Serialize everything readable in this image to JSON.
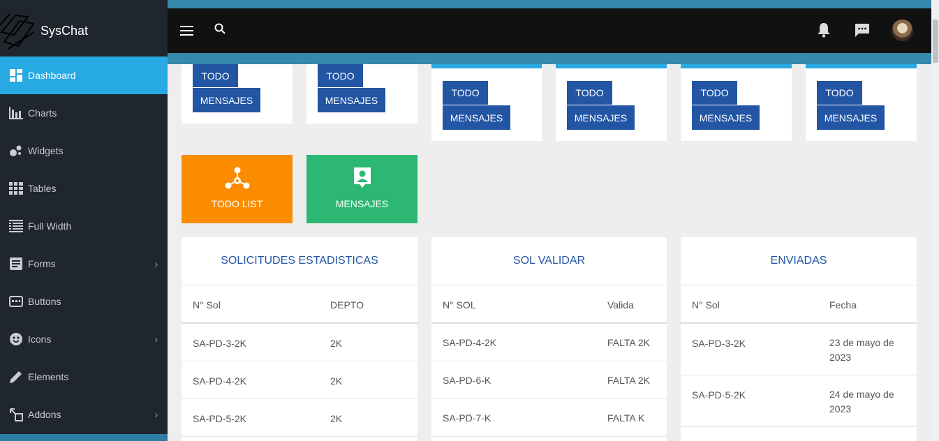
{
  "app": {
    "name": "SysChat"
  },
  "sidebar": {
    "items": [
      {
        "label": "Dashboard",
        "icon": "dashboard-icon",
        "active": true,
        "has_submenu": false
      },
      {
        "label": "Charts",
        "icon": "bar-chart-icon",
        "active": false,
        "has_submenu": false
      },
      {
        "label": "Widgets",
        "icon": "bubbles-icon",
        "active": false,
        "has_submenu": false
      },
      {
        "label": "Tables",
        "icon": "table-icon",
        "active": false,
        "has_submenu": false
      },
      {
        "label": "Full Width",
        "icon": "list-view-icon",
        "active": false,
        "has_submenu": false
      },
      {
        "label": "Forms",
        "icon": "form-icon",
        "active": false,
        "has_submenu": true
      },
      {
        "label": "Buttons",
        "icon": "button-icon",
        "active": false,
        "has_submenu": false
      },
      {
        "label": "Icons",
        "icon": "face-icon",
        "active": false,
        "has_submenu": true
      },
      {
        "label": "Elements",
        "icon": "pencil-icon",
        "active": false,
        "has_submenu": false
      },
      {
        "label": "Addons",
        "icon": "addons-icon",
        "active": false,
        "has_submenu": true
      }
    ]
  },
  "topbar": {
    "menu_icon": "hamburger-icon",
    "search_icon": "search-icon",
    "bell_icon": "bell-icon",
    "chat_icon": "chat-icon"
  },
  "cards": {
    "todo_label": "TODO",
    "mensajes_label": "MENSAJES"
  },
  "tiles": [
    {
      "label": "TODO LIST",
      "color": "#fb8c00",
      "icon": "hub-icon"
    },
    {
      "label": "MENSAJES",
      "color": "#2cb872",
      "icon": "contact-icon"
    }
  ],
  "colors": {
    "accent": "#27a9e3",
    "button_blue": "#2255a4",
    "sidebar_bg": "#1f262d",
    "topbar_bg": "#111111"
  },
  "tables": [
    {
      "title": "SOLICITUDES ESTADISTICAS",
      "headers": [
        "N° Sol",
        "DEPTO"
      ],
      "rows": [
        [
          "SA-PD-3-2K",
          "2K"
        ],
        [
          "SA-PD-4-2K",
          "2K"
        ],
        [
          "SA-PD-5-2K",
          "2K"
        ]
      ]
    },
    {
      "title": "SOL VALIDAR",
      "headers": [
        "N° SOL",
        "Valida"
      ],
      "rows": [
        [
          "SA-PD-4-2K",
          "FALTA 2K"
        ],
        [
          "SA-PD-6-K",
          "FALTA 2K"
        ],
        [
          "SA-PD-7-K",
          "FALTA K"
        ]
      ]
    },
    {
      "title": "ENVIADAS",
      "headers": [
        "N° Sol",
        "Fecha"
      ],
      "rows": [
        [
          "SA-PD-3-2K",
          "23 de mayo de 2023"
        ],
        [
          "SA-PD-5-2K",
          "24 de mayo de 2023"
        ]
      ]
    }
  ]
}
